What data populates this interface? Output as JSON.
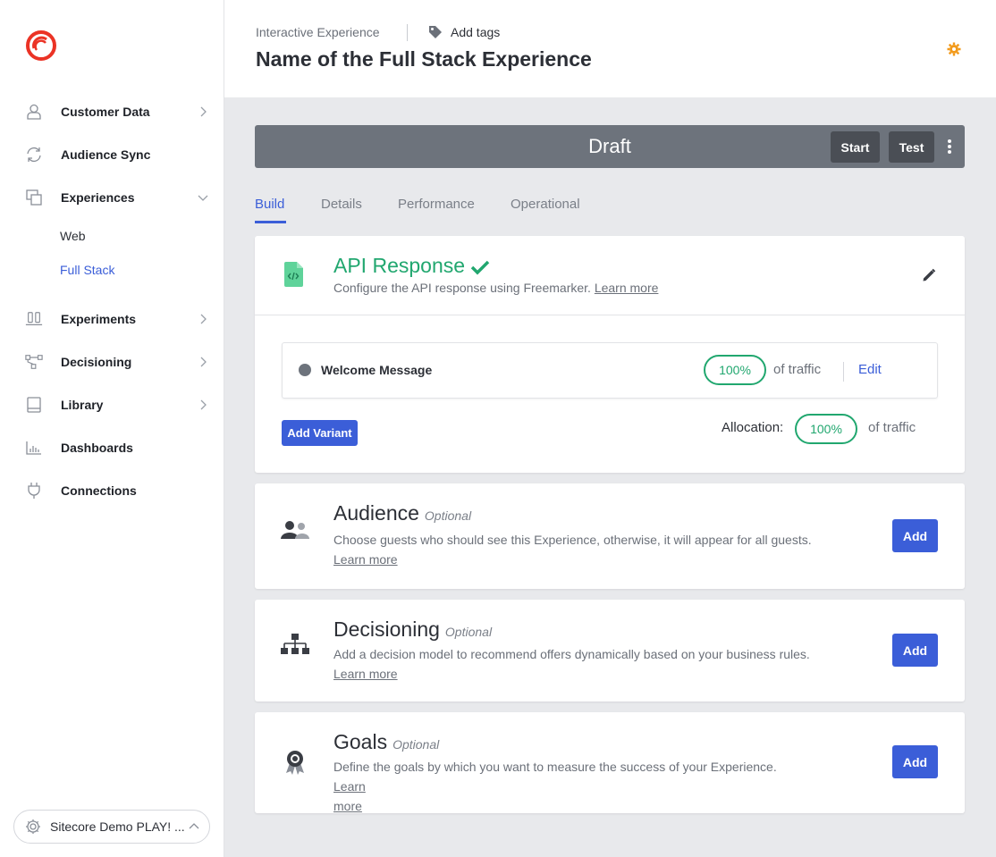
{
  "sidebar": {
    "items": [
      {
        "label": "Customer Data",
        "icon": "user-icon"
      },
      {
        "label": "Audience Sync",
        "icon": "sync-icon"
      },
      {
        "label": "Experiences",
        "icon": "experiences-icon"
      },
      {
        "label": "Experiments",
        "icon": "experiments-icon"
      },
      {
        "label": "Decisioning",
        "icon": "decisioning-icon"
      },
      {
        "label": "Library",
        "icon": "library-icon"
      },
      {
        "label": "Dashboards",
        "icon": "dashboards-icon"
      },
      {
        "label": "Connections",
        "icon": "connections-icon"
      }
    ],
    "sub_items": [
      {
        "label": "Web"
      },
      {
        "label": "Full Stack"
      }
    ],
    "org_label": "Sitecore Demo PLAY! ..."
  },
  "header": {
    "kind": "Interactive Experience",
    "tags_label": "Add tags",
    "title": "Name of the Full Stack Experience"
  },
  "status": {
    "label": "Draft",
    "start_label": "Start",
    "test_label": "Test"
  },
  "tabs": [
    {
      "label": "Build"
    },
    {
      "label": "Details"
    },
    {
      "label": "Performance"
    },
    {
      "label": "Operational"
    }
  ],
  "api_card": {
    "title": "API Response",
    "desc": "Configure the API response using Freemarker.",
    "learn_more": "Learn more",
    "variant": {
      "name": "Welcome Message",
      "percent": "100%",
      "of_traffic": "of traffic",
      "edit_label": "Edit"
    },
    "add_variant_label": "Add Variant",
    "allocation_label": "Allocation:",
    "allocation_percent": "100%",
    "allocation_of_traffic": "of traffic"
  },
  "audience_card": {
    "title": "Audience",
    "optional": "Optional",
    "desc": "Choose guests who should see this Experience, otherwise, it will appear for all guests.",
    "learn_more": "Learn more",
    "add_label": "Add"
  },
  "decisioning_card": {
    "title": "Decisioning",
    "optional": "Optional",
    "desc": "Add a decision model to recommend offers dynamically based on your business rules.",
    "learn_more": "Learn more",
    "add_label": "Add"
  },
  "goals_card": {
    "title": "Goals",
    "optional": "Optional",
    "desc": "Define the goals by which you want to measure the success of your Experience.",
    "learn_more_1": "Learn",
    "learn_more_2": "more",
    "add_label": "Add"
  },
  "colors": {
    "accent": "#3b5ed8",
    "success": "#21a76f",
    "brand": "#eb3325",
    "warning": "#f29a1b",
    "status_bar": "#6d737c"
  }
}
